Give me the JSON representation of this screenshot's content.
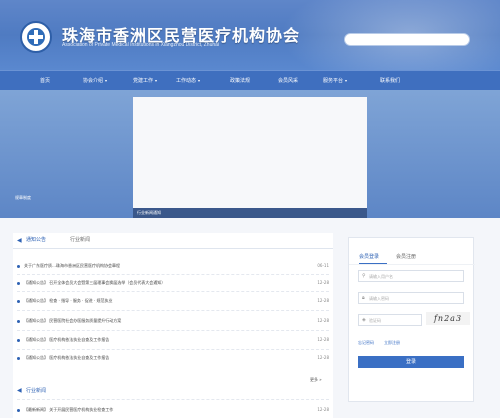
{
  "header": {
    "title": "珠海市香洲区民营医疗机构协会",
    "subtitle": "Association of Private Medical Institutions in Xiangzhou District, Zhuhai"
  },
  "nav": [
    {
      "label": "首页",
      "caret": ""
    },
    {
      "label": "协会介绍",
      "caret": "▾"
    },
    {
      "label": "党建工作",
      "caret": "▾"
    },
    {
      "label": "工作动态",
      "caret": "▾"
    },
    {
      "label": "政策法规",
      "caret": ""
    },
    {
      "label": "会员风采",
      "caret": ""
    },
    {
      "label": "服务平台",
      "caret": "▾"
    },
    {
      "label": "联系我们",
      "caret": ""
    }
  ],
  "banner": {
    "left_caption": "规章制度",
    "caption": "行业新闻通知"
  },
  "news": {
    "tabs": [
      "通知公告",
      "行业新闻"
    ],
    "rows": [
      {
        "text": "关于广东医疗质…珠海市香洲区民营医疗机构协会章程",
        "date": "06-11"
      },
      {
        "text": "【通知公告】 召开全体会员大会暨第三届理事会换届选举（会员代表大会通知）",
        "date": "12-28"
      },
      {
        "text": "【通知公告】 检查 · 指导 · 服务 · 促进 · 规范执业",
        "date": "12-28"
      },
      {
        "text": "【通知公告】 民营医院社会办医服务质量提升行动方案",
        "date": "12-28"
      },
      {
        "text": "【通知公告】 医疗机构依法执业自查及工作报告",
        "date": "12-28"
      },
      {
        "text": "【通知公告】 医疗机构依法执业自查及工作报告",
        "date": "12-28"
      }
    ],
    "more": "更多 »"
  },
  "section2": {
    "title": "行业新闻",
    "row": {
      "text": "【最新新闻】 关于开展民营医疗机构执业检查工作",
      "date": "12-28"
    }
  },
  "login": {
    "tabs": [
      "会员登录",
      "会员注册"
    ],
    "username_ph": "请输入用户名",
    "password_ph": "请输入密码",
    "captcha_ph": "验证码",
    "captcha": "fn2a3",
    "forgot": "忘记密码",
    "register": "立即注册",
    "button": "登录"
  }
}
